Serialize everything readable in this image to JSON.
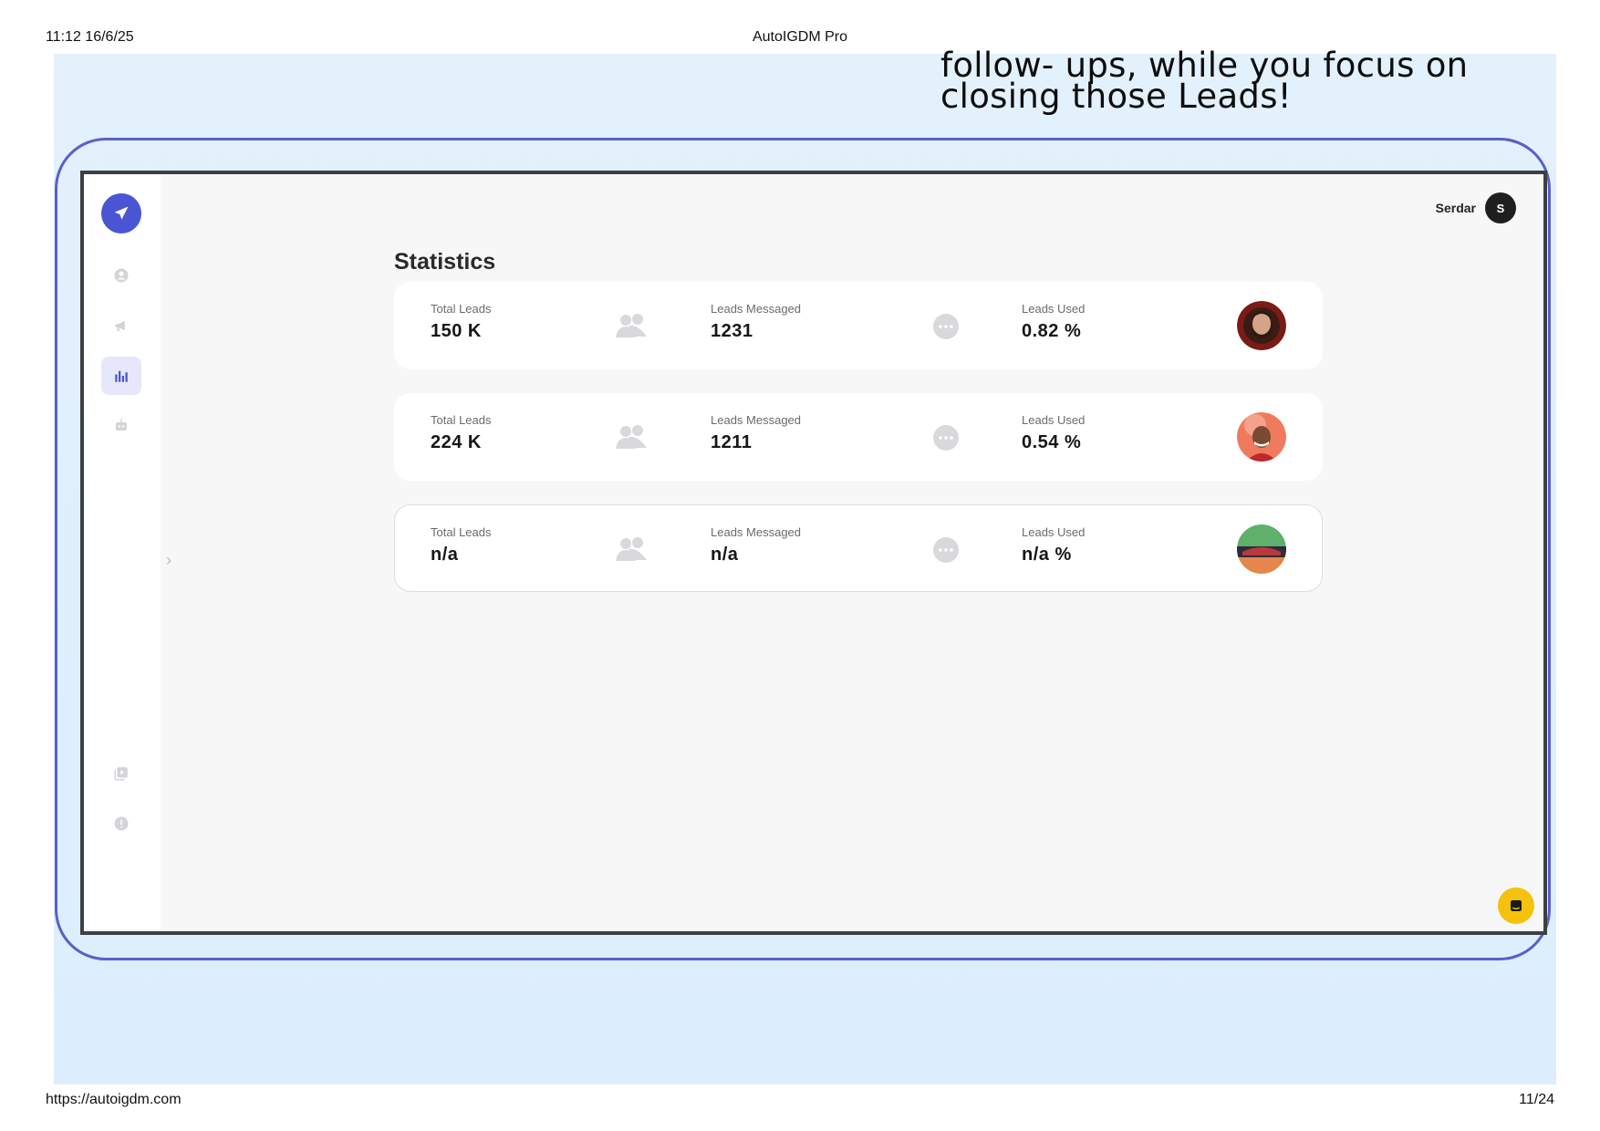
{
  "print_header": {
    "datetime": "11:12 16/6/25",
    "doc_title": "AutoIGDM Pro"
  },
  "print_footer": {
    "url": "https://autoigdm.com",
    "page": "11/24"
  },
  "slide": {
    "headline_line1": "follow- ups, while you focus on",
    "headline_line2": "closing those Leads!"
  },
  "app": {
    "user": {
      "name": "Serdar",
      "initial": "S"
    },
    "page_title": "Statistics",
    "sidebar": {
      "logo_icon": "paper-plane-icon",
      "items": [
        {
          "icon": "user-icon",
          "active": false
        },
        {
          "icon": "megaphone-icon",
          "active": false
        },
        {
          "icon": "bar-chart-icon",
          "active": true
        },
        {
          "icon": "robot-icon",
          "active": false
        },
        {
          "icon": "video-library-icon",
          "active": false
        },
        {
          "icon": "help-icon",
          "active": false
        }
      ],
      "collapse_icon": "chevron-right-icon"
    },
    "cards": [
      {
        "total_leads_label": "Total Leads",
        "total_leads_value": "150 K",
        "messaged_label": "Leads Messaged",
        "messaged_value": "1231",
        "used_label": "Leads Used",
        "used_value": "0.82 %"
      },
      {
        "total_leads_label": "Total Leads",
        "total_leads_value": "224 K",
        "messaged_label": "Leads Messaged",
        "messaged_value": "1211",
        "used_label": "Leads Used",
        "used_value": "0.54 %"
      },
      {
        "total_leads_label": "Total Leads",
        "total_leads_value": "n/a",
        "messaged_label": "Leads Messaged",
        "messaged_value": "n/a",
        "used_label": "Leads Used",
        "used_value": "n/a %"
      }
    ],
    "chat_button_icon": "chat-icon"
  },
  "colors": {
    "accent": "#4a55d4",
    "frame_border": "#5a5fc9",
    "slide_bg": "#e3f1fc",
    "chat_button": "#f4c20d"
  }
}
